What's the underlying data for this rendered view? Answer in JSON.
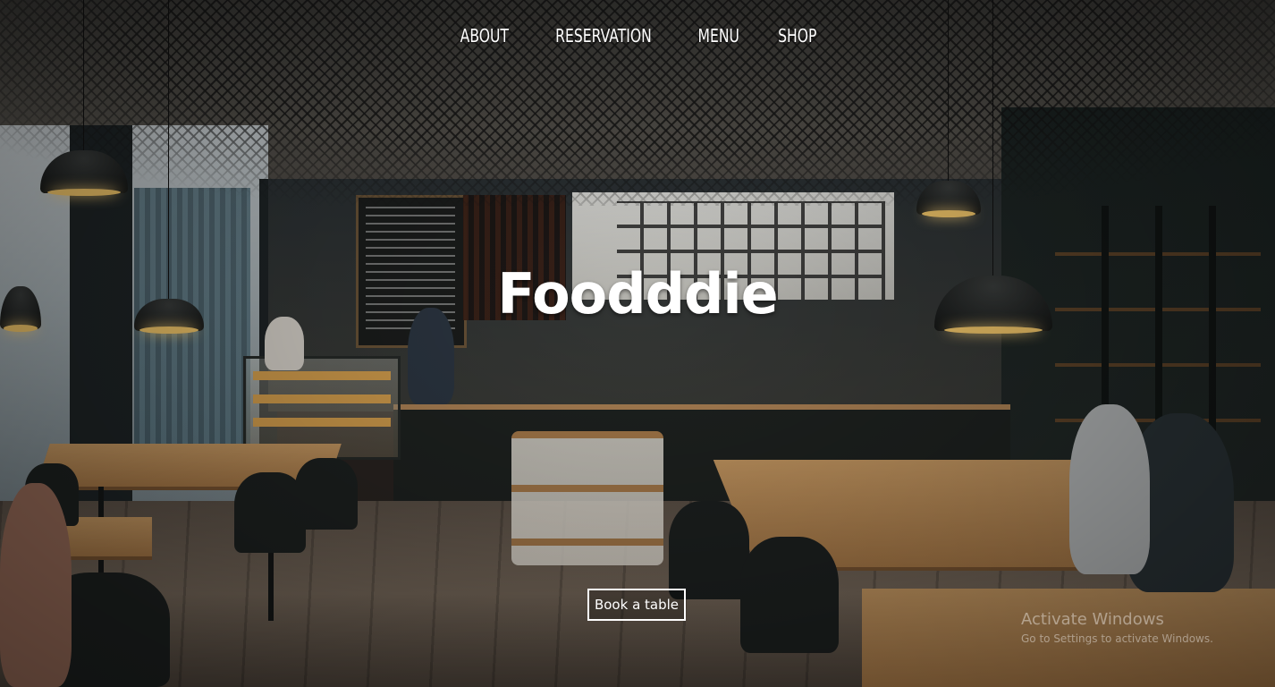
{
  "nav": {
    "items": [
      {
        "label": "ABOUT"
      },
      {
        "label": "RESERVATION"
      },
      {
        "label": "MENU"
      },
      {
        "label": "SHOP"
      }
    ]
  },
  "hero": {
    "title": "Foodddie",
    "cta_label": "Book a table"
  },
  "watermark": {
    "title": "Activate Windows",
    "subtitle": "Go to Settings to activate Windows."
  }
}
